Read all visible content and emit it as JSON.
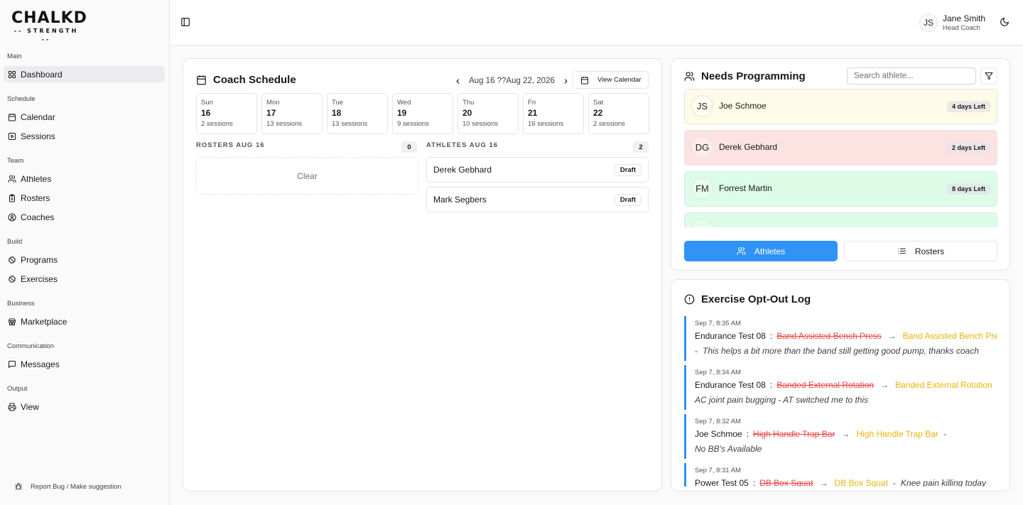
{
  "brand": {
    "line1": "CHALKD",
    "line2": "STRENGTH"
  },
  "sidebar": {
    "sections": [
      {
        "label": "Main",
        "items": [
          {
            "label": "Dashboard",
            "icon": "grid-icon",
            "active": true
          }
        ]
      },
      {
        "label": "Schedule",
        "items": [
          {
            "label": "Calendar",
            "icon": "calendar-icon"
          },
          {
            "label": "Sessions",
            "icon": "play-square-icon"
          }
        ]
      },
      {
        "label": "Team",
        "items": [
          {
            "label": "Athletes",
            "icon": "users-icon"
          },
          {
            "label": "Rosters",
            "icon": "clipboard-icon"
          },
          {
            "label": "Coaches",
            "icon": "user-circle-icon"
          }
        ]
      },
      {
        "label": "Build",
        "items": [
          {
            "label": "Programs",
            "icon": "dumbbell-icon"
          },
          {
            "label": "Exercises",
            "icon": "dumbbell-icon"
          }
        ]
      },
      {
        "label": "Business",
        "items": [
          {
            "label": "Marketplace",
            "icon": "store-icon"
          }
        ]
      },
      {
        "label": "Communication",
        "items": [
          {
            "label": "Messages",
            "icon": "message-icon"
          }
        ]
      },
      {
        "label": "Output",
        "items": [
          {
            "label": "View",
            "icon": "printer-icon"
          }
        ]
      }
    ],
    "report": "Report Bug / Make suggestion"
  },
  "header": {
    "user": {
      "initials": "JS",
      "name": "Jane Smith",
      "role": "Head Coach"
    }
  },
  "schedule": {
    "title": "Coach Schedule",
    "range": "Aug 16 ??Aug 22, 2026",
    "view_calendar": "View Calendar",
    "days": [
      {
        "name": "Sun",
        "date": "16",
        "sessions": "2 sessions"
      },
      {
        "name": "Mon",
        "date": "17",
        "sessions": "13 sessions"
      },
      {
        "name": "Tue",
        "date": "18",
        "sessions": "13 sessions"
      },
      {
        "name": "Wed",
        "date": "19",
        "sessions": "9 sessions"
      },
      {
        "name": "Thu",
        "date": "20",
        "sessions": "10 sessions"
      },
      {
        "name": "Fri",
        "date": "21",
        "sessions": "16 sessions"
      },
      {
        "name": "Sat",
        "date": "22",
        "sessions": "2 sessions"
      }
    ],
    "rosters_head": "ROSTERS AUG 16",
    "rosters_count": "0",
    "rosters_empty": "Clear",
    "athletes_head": "ATHLETES AUG 16",
    "athletes_count": "2",
    "athletes": [
      {
        "name": "Derek Gebhard",
        "status": "Draft"
      },
      {
        "name": "Mark Segbers",
        "status": "Draft"
      }
    ]
  },
  "needs": {
    "title": "Needs Programming",
    "search_placeholder": "Search athlete...",
    "rows": [
      {
        "initials": "JS",
        "name": "Joe Schmoe",
        "left": "4 days Left",
        "color": "#fefce8"
      },
      {
        "initials": "DG",
        "name": "Derek Gebhard",
        "left": "2 days Left",
        "color": "#fde2e2"
      },
      {
        "initials": "FM",
        "name": "Forrest Martin",
        "left": "8 days Left",
        "color": "#dcfce7"
      },
      {
        "initials": "",
        "name": "",
        "left": "",
        "color": "#dcfce7"
      }
    ],
    "tab_athletes": "Athletes",
    "tab_rosters": "Rosters"
  },
  "optout": {
    "title": "Exercise Opt-Out Log",
    "entries": [
      {
        "time": "Sep 7, 8:35 AM",
        "athlete": "Endurance Test 08",
        "from": "Band Assisted Bench Press",
        "to": "Band Assisted Bench Press",
        "note": "This helps a bit more than the band still getting good pump, thanks coach",
        "note_wrapped": true
      },
      {
        "time": "Sep 7, 8:34 AM",
        "athlete": "Endurance Test 08",
        "from": "Banded External Rotation",
        "to": "Banded External Rotation",
        "note": "AC joint pain bugging - AT switched me to this",
        "note_wrapped": true
      },
      {
        "time": "Sep 7, 8:32 AM",
        "athlete": "Joe Schmoe",
        "from": "High Handle Trap Bar",
        "to": "High Handle Trap Bar",
        "note": "No BB's Available",
        "note_wrapped": true
      },
      {
        "time": "Sep 7, 8:31 AM",
        "athlete": "Power Test 05",
        "from": "DB Box Squat",
        "to": "DB Box Squat",
        "note": "Knee pain killing today",
        "note_wrapped": false
      }
    ]
  },
  "colors": {
    "accent": "#3193f5",
    "removed": "#ef4444",
    "replacement": "#eab308"
  }
}
